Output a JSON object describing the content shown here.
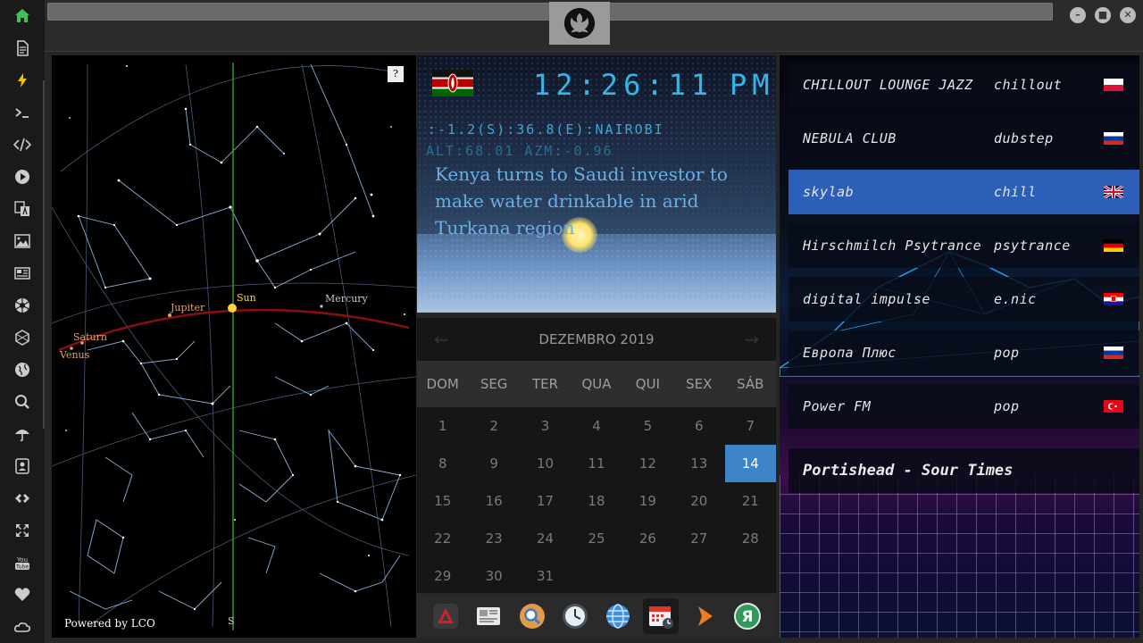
{
  "sidebar": {
    "items": [
      {
        "name": "home",
        "icon": "home-icon",
        "color": "#3fbf5a"
      },
      {
        "name": "document",
        "icon": "document-icon"
      },
      {
        "name": "flash",
        "icon": "lightning-icon",
        "color": "#f2c200"
      },
      {
        "name": "terminal",
        "icon": "terminal-icon"
      },
      {
        "name": "code",
        "icon": "code-icon"
      },
      {
        "name": "play",
        "icon": "play-icon"
      },
      {
        "name": "translate",
        "icon": "translate-icon"
      },
      {
        "name": "image",
        "icon": "image-icon"
      },
      {
        "name": "news",
        "icon": "newspaper-icon"
      },
      {
        "name": "aperture",
        "icon": "aperture-icon"
      },
      {
        "name": "hexagon",
        "icon": "hexagon-icon"
      },
      {
        "name": "globe",
        "icon": "globe-icon"
      },
      {
        "name": "search",
        "icon": "search-icon"
      },
      {
        "name": "umbrella",
        "icon": "umbrella-icon"
      },
      {
        "name": "contacts",
        "icon": "contacts-icon"
      },
      {
        "name": "link",
        "icon": "link-icon"
      },
      {
        "name": "expand",
        "icon": "expand-icon"
      },
      {
        "name": "youtube",
        "icon": "youtube-icon",
        "label": "You Tube"
      },
      {
        "name": "favorites",
        "icon": "heart-icon"
      },
      {
        "name": "cloud",
        "icon": "cloud-icon"
      }
    ]
  },
  "window": {
    "minimize": "–",
    "maximize": "■",
    "close": "✕"
  },
  "sky": {
    "help": "?",
    "credit": "Powered by LCO",
    "south": "S",
    "planets": {
      "sun": "Sun",
      "jupiter": "Jupiter",
      "mercury": "Mercury",
      "saturn": "Saturn",
      "venus": "Venus"
    }
  },
  "clock": {
    "time": "12:26:11",
    "ampm": "PM",
    "coords": ":-1.2(S):36.8(E):NAIROBI",
    "altaz": "ALT:68.01 AZM:-0.96",
    "headline": "Kenya turns to Saudi investor to make water drinkable in arid Turkana region",
    "lcd_color": "#35b6e8"
  },
  "calendar": {
    "month_label": "DEZEMBRO 2019",
    "prev": "←",
    "next": "→",
    "weekdays": [
      "DOM",
      "SEG",
      "TER",
      "QUA",
      "QUI",
      "SEX",
      "SÁB"
    ],
    "weeks": [
      [
        "1",
        "2",
        "3",
        "4",
        "5",
        "6",
        "7"
      ],
      [
        "8",
        "9",
        "10",
        "11",
        "12",
        "13",
        "14"
      ],
      [
        "15",
        "16",
        "17",
        "18",
        "19",
        "20",
        "21"
      ],
      [
        "22",
        "23",
        "24",
        "25",
        "26",
        "27",
        "28"
      ],
      [
        "29",
        "30",
        "31",
        "",
        "",
        "",
        ""
      ]
    ],
    "today": "14",
    "today_color": "#3d85c6"
  },
  "dock": {
    "items": [
      {
        "name": "dock-app-red",
        "icon": "triangle-app-icon"
      },
      {
        "name": "dock-news",
        "icon": "news-app-icon"
      },
      {
        "name": "dock-search",
        "icon": "magnifier-app-icon"
      },
      {
        "name": "dock-clock",
        "icon": "clock-app-icon"
      },
      {
        "name": "dock-browser",
        "icon": "globe-app-icon"
      },
      {
        "name": "dock-calendar",
        "icon": "calendar-app-icon",
        "active": true
      },
      {
        "name": "dock-play",
        "icon": "play-app-icon"
      },
      {
        "name": "dock-yandex",
        "icon": "yandex-app-icon",
        "label": "Я"
      }
    ]
  },
  "radio": {
    "stations": [
      {
        "name": "CHILLOUT LOUNGE JAZZ",
        "genre": "chillout",
        "flag": "pl"
      },
      {
        "name": "NEBULA CLUB",
        "genre": "dubstep",
        "flag": "ru"
      },
      {
        "name": "skylab",
        "genre": "chill",
        "flag": "uk",
        "active": true
      },
      {
        "name": "Hirschmilch Psytrance",
        "genre": "psytrance",
        "flag": "de"
      },
      {
        "name": "digital impulse",
        "genre": "e.nic",
        "flag": "hr"
      },
      {
        "name": "Европа Плюс",
        "genre": "pop",
        "flag": "ru"
      },
      {
        "name": "Power FM",
        "genre": "pop",
        "flag": "tr"
      }
    ],
    "now_playing": "Portishead - Sour Times",
    "active_color": "#2d5fb8"
  }
}
